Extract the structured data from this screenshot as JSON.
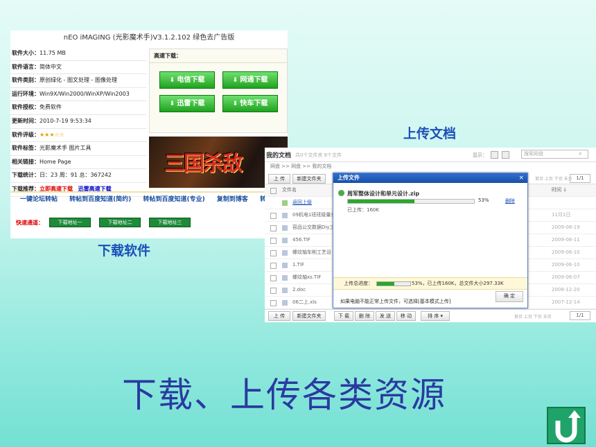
{
  "software_panel": {
    "title": "nEO iMAGING (光影魔术手)V3.1.2.102 绿色去广告版",
    "info_rows": [
      {
        "label": "软件大小：",
        "value": "11.75 MB"
      },
      {
        "label": "软件语言：",
        "value": "简体中文"
      },
      {
        "label": "软件类别：",
        "value": "原创绿化 - 图文处理 - 图像处理"
      },
      {
        "label": "运行环境：",
        "value": "Win9X/Win2000/WinXP/Win2003"
      },
      {
        "label": "软件授权：",
        "value": "免费软件"
      },
      {
        "label": "更新时间：",
        "value": "2010-7-19 9:53:34"
      },
      {
        "label": "软件评级：",
        "value": "★★★☆☆"
      },
      {
        "label": "软件标签：",
        "value": "光影魔术手 图片工具"
      },
      {
        "label": "相关链接：",
        "value": "Home Page"
      },
      {
        "label": "下载统计：",
        "value": "日：23  周：91  总：367242"
      }
    ],
    "recommend_label": "下载推荐：",
    "recommend_link_1": "立即高速下载",
    "recommend_link_2": "迅雷高速下载",
    "download_header": "高速下载：",
    "buttons": [
      "电信下载",
      "网通下载",
      "迅雷下载",
      "快车下载"
    ],
    "banner_text": "三国杀敌",
    "share_links": [
      "一键论坛转帖",
      "转帖到百度知道(简约)",
      "转帖到百度知道(专业)",
      "复制到博客",
      "转"
    ],
    "fast_channel_label": "快速通道：",
    "fast_buttons": [
      "下载地址一",
      "下载地址二",
      "下载地址三"
    ]
  },
  "caption_download": "下载软件",
  "caption_upload": "上传文档",
  "upload_panel": {
    "header_title": "我的文档",
    "header_count": "共0个文件夹 8个文件",
    "display_label": "显示：",
    "search_placeholder": "搜索网盘",
    "breadcrumb": "网盘 >> 网盘 >> 我的文档",
    "toolbar": [
      "上 传",
      "新建文件夹",
      "下 载",
      "删 除",
      "发 送",
      "移 动",
      "排 序 ▾"
    ],
    "col_name": "文件名",
    "col_time": "时间 ↓",
    "pager": "首页 上页 下页 末页",
    "pager_page": "1/1",
    "files": [
      {
        "name": "返回上级",
        "date": ""
      },
      {
        "name": "09机电1班班级量化",
        "date": "11月1日"
      },
      {
        "name": "容品公交数据Diy工",
        "date": "2009-08-19"
      },
      {
        "name": "456.TIF",
        "date": "2009-06-11"
      },
      {
        "name": "螺纹轴车削工艺设",
        "date": "2009-06-10"
      },
      {
        "name": "1.TIF",
        "date": "2009-06-10"
      },
      {
        "name": "螺纹轴xs.TIF",
        "date": "2009-06-07"
      },
      {
        "name": "2.doc",
        "date": "2008-12-20"
      },
      {
        "name": "06二上.xls",
        "date": "2007-12-14"
      }
    ],
    "dialog": {
      "title": "上传文件",
      "close": "×",
      "file_name": "周军整体设计和单元设计.zip",
      "progress": 53,
      "progress_text": "53%",
      "delete": "删除",
      "uploaded": "已上传：160K",
      "total_label": "上传总进度：",
      "total_progress": 53,
      "total_text": "53%，已上传160K，总文件大小297.33K",
      "footer_text": "如果电脑不能正常上传文件，可选择[基本模式上传]",
      "ok": "确 定"
    }
  },
  "main_title": "下载、上传各类资源",
  "colors": {
    "accent_green": "#1fa21f",
    "title_blue": "#2a3aa0",
    "caption_blue": "#1a4fb8"
  }
}
